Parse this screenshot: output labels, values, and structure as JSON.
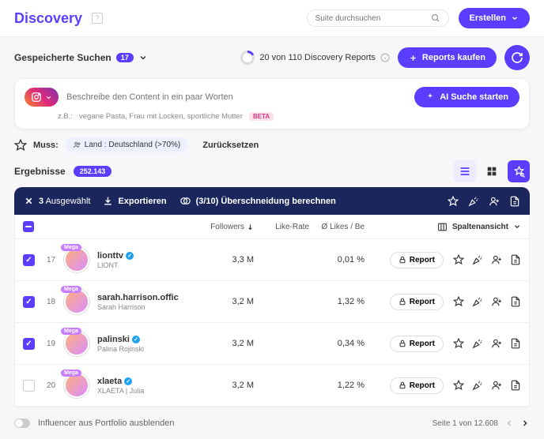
{
  "header": {
    "logo": "Discovery",
    "search_placeholder": "Suite durchsuchen",
    "create_label": "Erstellen"
  },
  "saved": {
    "label": "Gespeicherte Suchen",
    "count": "17"
  },
  "quota": {
    "text": "20 von 110 Discovery Reports",
    "buy_label": "Reports kaufen"
  },
  "ai": {
    "placeholder": "Beschreibe den Content in ein paar Worten",
    "start_label": "AI Suche starten",
    "hint_prefix": "z.B.:",
    "hint_text": "vegane Pasta, Frau mit Locken, sportliche Mutter",
    "beta": "BETA"
  },
  "filters": {
    "muss": "Muss:",
    "chip_land": "Land : Deutschland (>70%)",
    "reset": "Zurücksetzen"
  },
  "results": {
    "label": "Ergebnisse",
    "count": "252.143"
  },
  "selbar": {
    "count": "3",
    "selected": "Ausgewählt",
    "export": "Exportieren",
    "overlap": "(3/10) Überschneidung berechnen"
  },
  "cols": {
    "followers": "Followers",
    "like_rate": "Like-Rate",
    "likes_be": "Ø Likes / Be",
    "columns": "Spaltenansicht"
  },
  "rows": [
    {
      "rank": "17",
      "user": "lionttv",
      "name": "LIONT",
      "verified": true,
      "followers": "3,3 M",
      "like_rate": "",
      "likes_be": "0,01 %",
      "checked": true,
      "tier": "Mega"
    },
    {
      "rank": "18",
      "user": "sarah.harrison.offic",
      "name": "Sarah Harrison",
      "verified": false,
      "followers": "3,2 M",
      "like_rate": "",
      "likes_be": "1,32 %",
      "checked": true,
      "tier": "Mega"
    },
    {
      "rank": "19",
      "user": "palinski",
      "name": "Palina Rojinski",
      "verified": true,
      "followers": "3,2 M",
      "like_rate": "",
      "likes_be": "0,34 %",
      "checked": true,
      "tier": "Mega"
    },
    {
      "rank": "20",
      "user": "xlaeta",
      "name": "XLAETA | Julia",
      "verified": true,
      "followers": "3,2 M",
      "like_rate": "",
      "likes_be": "1,22 %",
      "checked": false,
      "tier": "Mega"
    }
  ],
  "report_label": "Report",
  "footer": {
    "hide_portfolio": "Influencer aus Portfolio ausblenden",
    "page_text": "Seite 1 von 12.608"
  }
}
